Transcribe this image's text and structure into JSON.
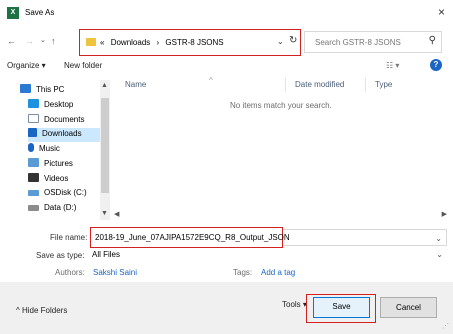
{
  "window": {
    "title": "Save As",
    "app_icon": "X",
    "close": "×"
  },
  "nav": {
    "back": "←",
    "forward": "→",
    "recent": "⌄",
    "up": "↑"
  },
  "address": {
    "crumbs": [
      "«",
      "Downloads",
      "›",
      "GSTR-8 JSONS"
    ],
    "dropdown": "⌄",
    "refresh": "↻"
  },
  "search": {
    "placeholder": "Search GSTR-8 JSONS",
    "icon": "⚲"
  },
  "toolbar": {
    "organize": "Organize ▾",
    "new_folder": "New folder",
    "view": "☷ ▾",
    "help": "?"
  },
  "sidebar": {
    "items": [
      {
        "label": "This PC",
        "icon": "pc-icon",
        "color": "#2b79d3"
      },
      {
        "label": "Desktop",
        "icon": "desktop-icon",
        "color": "#1e90e0"
      },
      {
        "label": "Documents",
        "icon": "documents-icon",
        "color": "#7d8fa5"
      },
      {
        "label": "Downloads",
        "icon": "downloads-icon",
        "color": "#1a66c2"
      },
      {
        "label": "Music",
        "icon": "music-icon",
        "color": "#1a66c2"
      },
      {
        "label": "Pictures",
        "icon": "pictures-icon",
        "color": "#5b9bd5"
      },
      {
        "label": "Videos",
        "icon": "videos-icon",
        "color": "#333333"
      },
      {
        "label": "OSDisk (C:)",
        "icon": "drive-icon",
        "color": "#5b9bd5"
      },
      {
        "label": "Data (D:)",
        "icon": "drive-icon",
        "color": "#8c8c8c"
      }
    ],
    "selected_index": 3
  },
  "filelist": {
    "columns": [
      "Name",
      "Date modified",
      "Type"
    ],
    "sort_indicator": "^",
    "empty_message": "No items match your search."
  },
  "form": {
    "filename_label": "File name:",
    "filename_value": "2018-19_June_07AJIPA1572E9CQ_R8_Output_JSON",
    "savetype_label": "Save as type:",
    "savetype_value": "All Files",
    "authors_label": "Authors:",
    "authors_value": "Sakshi Saini",
    "tags_label": "Tags:",
    "tags_value": "Add a tag"
  },
  "footer": {
    "hide_folders": "Hide Folders",
    "tools": "Tools ▾",
    "save": "Save",
    "cancel": "Cancel"
  },
  "colors": {
    "highlight_border": "#d32020",
    "link": "#1a66c2",
    "selection": "#cce8ff"
  }
}
